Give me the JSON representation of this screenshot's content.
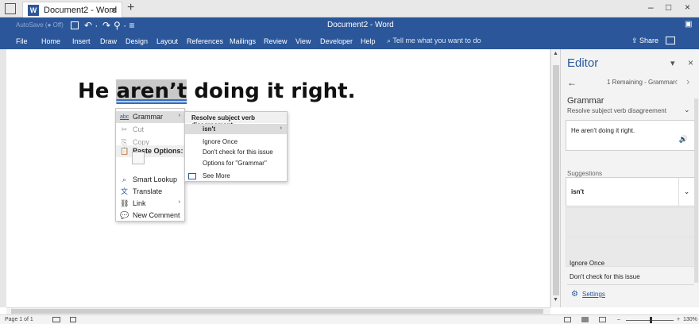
{
  "tab": {
    "title": "Document2 - Word",
    "close": "×",
    "new": "+"
  },
  "window": {
    "minimize": "–",
    "maximize": "□",
    "close": "×"
  },
  "titlebar": {
    "autosave": "AutoSave (● Off)",
    "save_icon": "save-icon",
    "undo": "↶ ·",
    "redo": "↷",
    "extra": "⚲ · ≡",
    "doc_title": "Document2  -  Word",
    "box": "▣"
  },
  "ribbon": {
    "tabs": [
      "File",
      "Home",
      "Insert",
      "Draw",
      "Design",
      "Layout",
      "References",
      "Mailings",
      "Review",
      "View",
      "Developer",
      "Help"
    ],
    "tell_me": "Tell me what you want to do",
    "share": "Share"
  },
  "document": {
    "before": "He ",
    "error_word": "aren’t",
    "after": " doing it right."
  },
  "context_menu": {
    "items": [
      {
        "icon": "abc",
        "label": "Grammar",
        "submenu": "›"
      },
      {
        "icon": "✂",
        "label": "Cut"
      },
      {
        "icon": "⎘",
        "label": "Copy"
      },
      {
        "icon": "📋",
        "label": "Paste Options:"
      },
      {
        "icon": "⌕",
        "label": "Smart Lookup"
      },
      {
        "icon": "文",
        "label": "Translate"
      },
      {
        "icon": "⛓",
        "label": "Link",
        "submenu": "›"
      },
      {
        "icon": "💬",
        "label": "New Comment"
      }
    ]
  },
  "grammar_submenu": {
    "header": "Resolve subject verb disagreement",
    "suggestion": "isn't",
    "arrow": "›",
    "ignore": "Ignore Once",
    "dont_check": "Don't check for this issue",
    "options": "Options for \"Grammar\"",
    "see_more": "See More"
  },
  "editor": {
    "title": "Editor",
    "dropdown": "▾",
    "close": "×",
    "back": "←",
    "remaining": "1 Remaining - Grammar",
    "prev": "‹",
    "next": "›",
    "grammar_title": "Grammar",
    "grammar_sub": "Resolve subject verb disagreement",
    "chevron": "⌄",
    "snippet": "He aren't doing it right.",
    "speaker": "🔊",
    "suggestions_label": "Suggestions",
    "suggestion_value": "isn't",
    "ignore_once": "Ignore Once",
    "dont_check": "Don't check for this issue",
    "settings": "Settings",
    "gear": "⚙"
  },
  "status": {
    "page": "Page 1 of 1",
    "zoom_out": "–",
    "zoom_in": "+",
    "zoom": "130%"
  },
  "colors": {
    "accent": "#2b579a",
    "error_underline": "#2e6ec8"
  }
}
